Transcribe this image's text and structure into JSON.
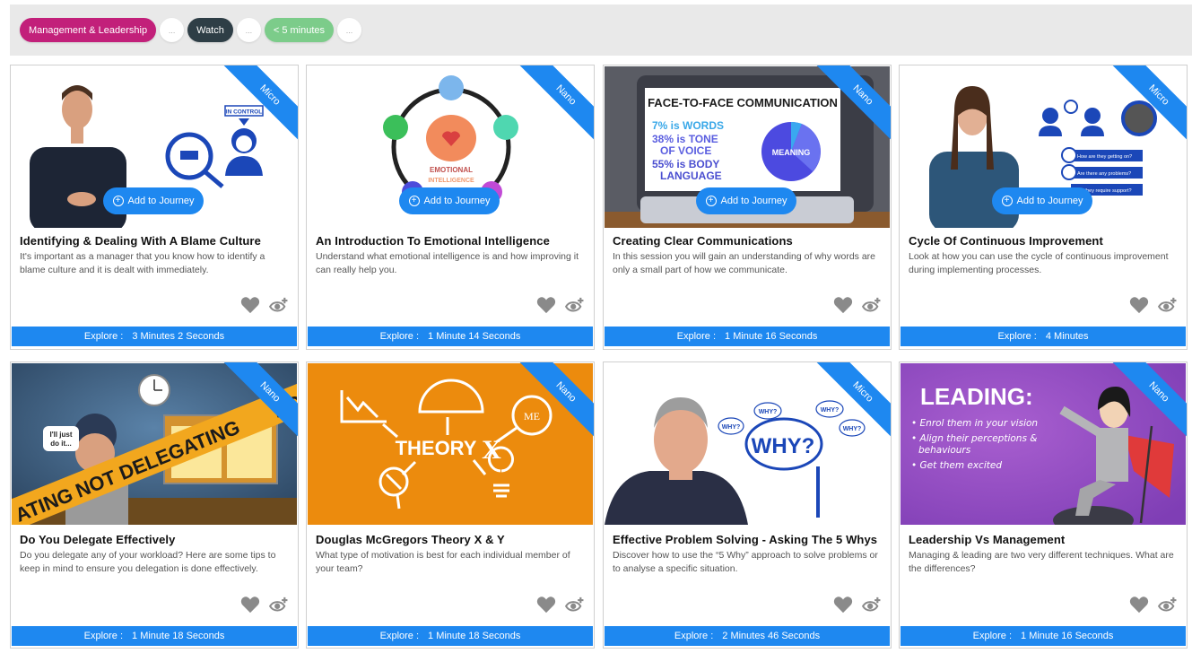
{
  "filters": {
    "chips": [
      {
        "label": "Management & Leadership",
        "color": "#c2207a"
      },
      {
        "label": "Watch",
        "color": "#2e3e46"
      },
      {
        "label": "< 5 minutes",
        "color": "#7ccc8a"
      }
    ],
    "more_label": "..."
  },
  "card_common": {
    "add_to_journey": "Add to Journey",
    "explore_label": "Explore :"
  },
  "cards": [
    {
      "title": "Identifying & Dealing With A Blame Culture",
      "description": "It's important as a manager that you know how to identify a blame culture and it is dealt with immediately.",
      "ribbon": "Micro",
      "duration": "3 Minutes 2 Seconds",
      "show_journey": true,
      "thumb_text": [
        "IN CONTROL"
      ]
    },
    {
      "title": "An Introduction To Emotional Intelligence",
      "description": "Understand what emotional intelligence is and how improving it can really help you.",
      "ribbon": "Nano",
      "duration": "1 Minute 14 Seconds",
      "show_journey": true,
      "thumb_text": [
        "EMOTIONAL",
        "INTELLIGENCE"
      ]
    },
    {
      "title": "Creating Clear Communications",
      "description": "In this session you will gain an understanding of why words are only a small part of how we communicate.",
      "ribbon": "Nano",
      "duration": "1 Minute 16 Seconds",
      "show_journey": true,
      "thumb_text": [
        "FACE-TO-FACE COMMUNICATION",
        "7% is WORDS",
        "38% is TONE",
        "OF VOICE",
        "55% is BODY",
        "LANGUAGE",
        "MEANING"
      ]
    },
    {
      "title": "Cycle Of Continuous Improvement",
      "description": "Look at how you can use the cycle of continuous improvement during implementing processes.",
      "ribbon": "Micro",
      "duration": "4 Minutes",
      "show_journey": true,
      "thumb_text": [
        "How are they getting on?",
        "Are there any problems?",
        "Do they require support?"
      ]
    },
    {
      "title": "Do You Delegate Effectively",
      "description": "Do you delegate any of your workload? Here are some tips to keep in mind to ensure you delegation is done effectively.",
      "ribbon": "Nano",
      "duration": "1 Minute 18 Seconds",
      "show_journey": false,
      "thumb_text": [
        "I'll just",
        "do it...",
        "NOT DELEGATING",
        "NO",
        "ATING"
      ]
    },
    {
      "title": "Douglas McGregors Theory X & Y",
      "description": "What type of motivation is best for each individual member of your team?",
      "ribbon": "Nano",
      "duration": "1 Minute 18 Seconds",
      "show_journey": false,
      "thumb_text": [
        "THEORY",
        "X",
        "ME"
      ]
    },
    {
      "title": "Effective Problem Solving - Asking The 5 Whys",
      "description": "Discover how to use the “5 Why” approach to solve problems or to analyse a specific situation.",
      "ribbon": "Micro",
      "duration": "2 Minutes 46 Seconds",
      "show_journey": false,
      "thumb_text": [
        "WHY?"
      ]
    },
    {
      "title": "Leadership Vs Management",
      "description": "Managing & leading are two very different techniques. What are the differences?",
      "ribbon": "Nano",
      "duration": "1 Minute 16 Seconds",
      "show_journey": false,
      "thumb_text": [
        "LEADING:",
        "Enrol them in your vision",
        "Align their perceptions &",
        "behaviours",
        "Get them excited"
      ]
    }
  ],
  "colors": {
    "accent": "#1e88f0",
    "icon_gray": "#8a8a8a"
  }
}
